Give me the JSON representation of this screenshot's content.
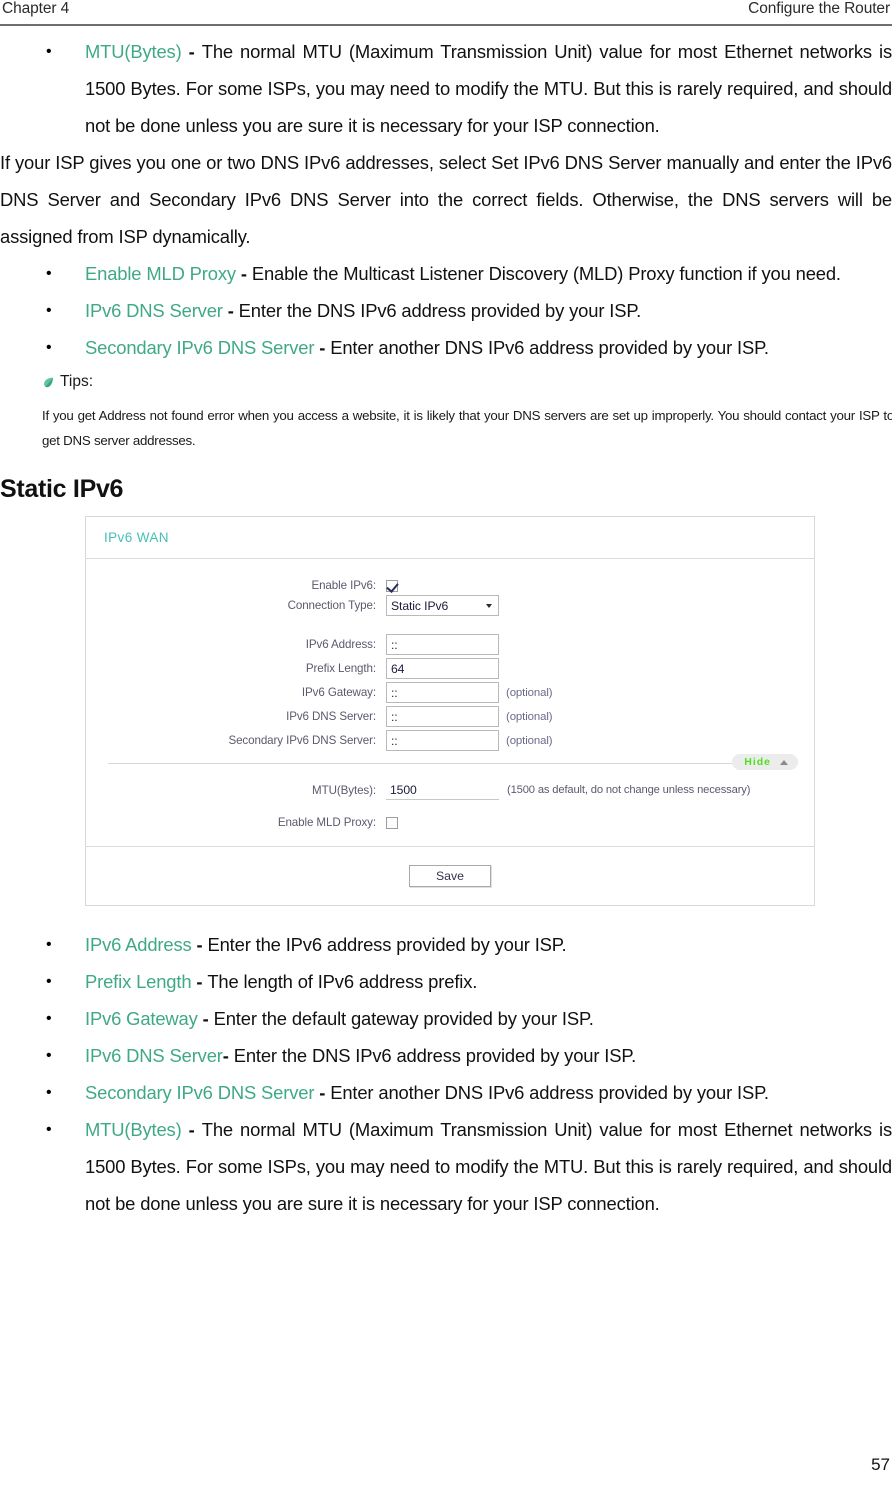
{
  "header": {
    "chapter": "Chapter 4",
    "section": "Configure the Router"
  },
  "top_bullets": [
    {
      "term": "MTU(Bytes)",
      "dash": " - ",
      "text": "The normal MTU (Maximum Transmission Unit) value for most Ethernet networks is 1500 Bytes. For some ISPs, you may need to modify the MTU. But this is rarely required, and should not be done unless you are sure it is necessary for your ISP connection."
    }
  ],
  "paragraph": "If your ISP gives you one or two DNS IPv6 addresses, select Set IPv6 DNS Server manually and enter the IPv6 DNS Server and Secondary IPv6 DNS Server into the correct fields. Otherwise, the DNS servers will be assigned from ISP dynamically.",
  "mid_bullets": [
    {
      "term": "Enable MLD Proxy",
      "dash": " - ",
      "text": "Enable the Multicast Listener Discovery (MLD) Proxy function if you need."
    },
    {
      "term": "IPv6 DNS Server",
      "dash": " - ",
      "text": "Enter the DNS IPv6 address provided by your ISP."
    },
    {
      "term": "Secondary IPv6 DNS Server",
      "dash": " - ",
      "text": "Enter another DNS IPv6 address provided by your ISP."
    }
  ],
  "tips": {
    "icon": "leaf-icon",
    "label": "Tips:",
    "body": "If you get Address not found error when you access a website, it is likely that your DNS servers are set up improperly. You should contact your ISP to get DNS server addresses."
  },
  "section_title": "Static IPv6",
  "screenshot": {
    "panel_title": "IPv6 WAN",
    "enable_ipv6": {
      "label": "Enable IPv6:",
      "checked": true
    },
    "connection_type": {
      "label": "Connection Type:",
      "value": "Static IPv6",
      "options": [
        "Static IPv6"
      ]
    },
    "fields": [
      {
        "label": "IPv6 Address:",
        "value": "::",
        "note": ""
      },
      {
        "label": "Prefix Length:",
        "value": "64",
        "note": ""
      },
      {
        "label": "IPv6 Gateway:",
        "value": "::",
        "note": "(optional)"
      },
      {
        "label": "IPv6 DNS Server:",
        "value": "::",
        "note": "(optional)"
      },
      {
        "label": "Secondary IPv6 DNS Server:",
        "value": "::",
        "note": "(optional)"
      }
    ],
    "hide_button": {
      "label": "Hide",
      "caret": "chevron-up-icon"
    },
    "mtu": {
      "label": "MTU(Bytes):",
      "value": "1500",
      "note": "(1500 as default, do not change unless necessary)"
    },
    "mld_proxy": {
      "label": "Enable MLD Proxy:",
      "checked": false
    },
    "save_label": "Save"
  },
  "bottom_bullets": [
    {
      "term": "IPv6 Address",
      "dash": " - ",
      "text": "Enter the IPv6 address provided by your ISP."
    },
    {
      "term": "Prefix Length",
      "dash": " - ",
      "text": "The length of IPv6 address prefix."
    },
    {
      "term": "IPv6 Gateway",
      "dash": " - ",
      "text": "Enter the default gateway provided by your ISP."
    },
    {
      "term": "IPv6 DNS Server",
      "dash": "- ",
      "text": "Enter the DNS IPv6 address provided by your ISP."
    },
    {
      "term": "Secondary IPv6 DNS Server",
      "dash": " - ",
      "text": "Enter another DNS IPv6 address provided by your ISP."
    },
    {
      "term": "MTU(Bytes)",
      "dash": " - ",
      "text": "The normal MTU (Maximum Transmission Unit) value for most Ethernet networks is 1500 Bytes. For some ISPs, you may need to modify the MTU. But this is rarely required, and should not be done unless you are sure it is necessary for your ISP connection."
    }
  ],
  "page_number": "57",
  "colors": {
    "term_teal": "#3FA987",
    "panel_title_teal": "#45C0B6",
    "hide_green": "#4FE11A",
    "rule_gray": "#6F6F6F"
  }
}
